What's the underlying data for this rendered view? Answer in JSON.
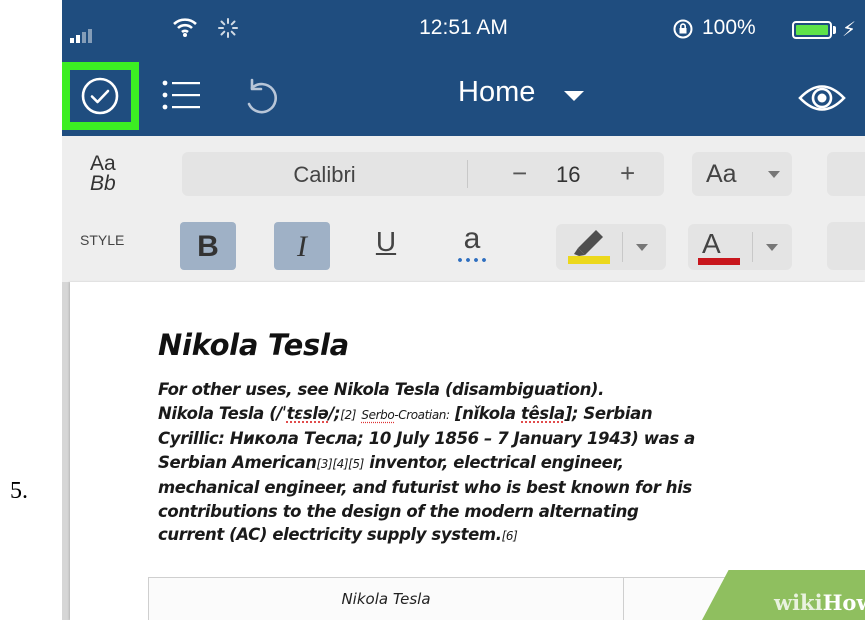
{
  "step": {
    "number": "5."
  },
  "status_bar": {
    "time": "12:51 AM",
    "battery_percent": "100%",
    "battery_level": 1.0,
    "battery_color": "#5ee34a"
  },
  "toolbar": {
    "home_label": "Home",
    "highlight_color": "#3cee22",
    "bar_color": "#1f4d7f",
    "icons": [
      "done-check-icon",
      "list-icon",
      "undo-icon",
      "dropdown-caret-icon",
      "read-mode-eye-icon"
    ]
  },
  "format_panel": {
    "style_aa": "Aa",
    "style_bb": "Bb",
    "style_label": "STYLE",
    "font_name": "Calibri",
    "size_minus": "−",
    "font_size": "16",
    "size_plus": "+",
    "case_label": "Aa",
    "bold_label": "B",
    "italic_label": "I",
    "underline_label": "U",
    "spelling_label": "a",
    "highlight_color": "#ecd81c",
    "font_color_label": "A",
    "font_color": "#c8161d"
  },
  "document": {
    "title": "Nikola Tesla",
    "lines": {
      "l1": "For other uses, see Nikola Tesla (disambiguation).",
      "l2a": "Nikola Tesla (/ˈ",
      "l2b": "tɛslə",
      "l2c": "/;",
      "l2d": "[2]",
      "l2e": "Serbo",
      "l2f": "-Croatian:",
      "l2g": " [nǐkola ",
      "l2h": "têsla",
      "l2i": "]; Serbian",
      "l3": "Cyrillic: Никола Тесла; 10 July 1856 – 7 January 1943) was a",
      "l4a": "Serbian American",
      "l4b": "[3][4][5]",
      "l4c": " inventor, electrical engineer,",
      "l5": "mechanical engineer, and futurist who is best known for his",
      "l6": "contributions to the design of the modern alternating",
      "l7a": "current (AC) electricity supply system.",
      "l7b": "[6]"
    },
    "infobox_title": "Nikola Tesla"
  },
  "watermark": {
    "wiki": "wiki",
    "how": "How"
  }
}
